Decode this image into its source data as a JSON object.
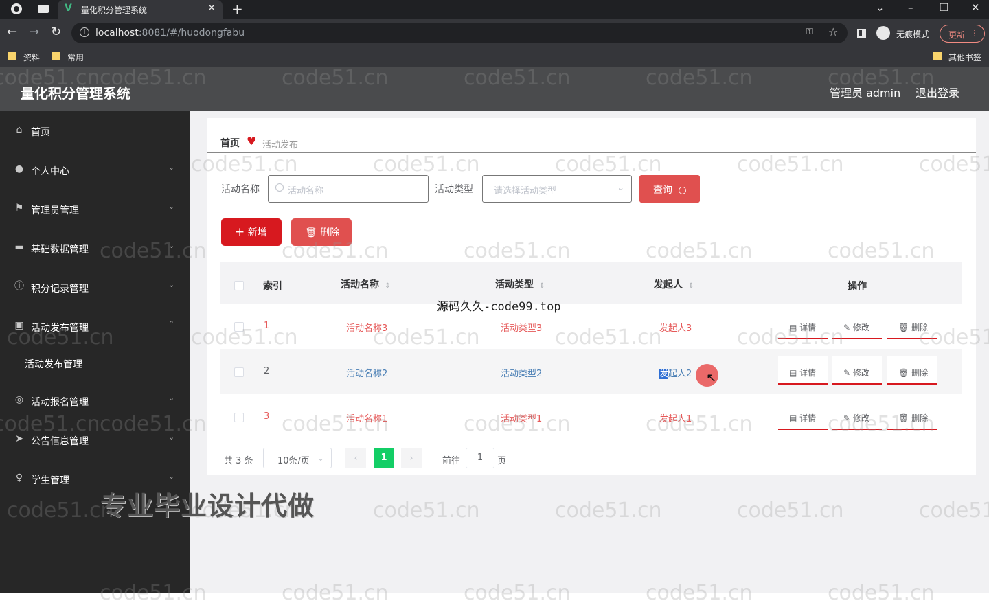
{
  "browser": {
    "tab_title": "量化积分管理系统",
    "tab_favicon": "V",
    "url_host": "localhost",
    "url_path": ":8081/#/huodongfabu",
    "incognito_label": "无痕模式",
    "update_label": "更新",
    "bookmarks": [
      "资料",
      "常用",
      "其他书签"
    ],
    "icons": [
      "back-icon",
      "forward-icon",
      "reload-icon",
      "key-icon",
      "star-icon",
      "incognito-icon",
      "kebab-icon"
    ]
  },
  "header": {
    "title": "量化积分管理系统",
    "admin_label": "管理员 admin",
    "logout_label": "退出登录"
  },
  "sidebar": {
    "items": [
      {
        "label": "首页",
        "icon": "home-icon"
      },
      {
        "label": "个人中心",
        "icon": "user-icon"
      },
      {
        "label": "管理员管理",
        "icon": "flag-icon"
      },
      {
        "label": "基础数据管理",
        "icon": "chat-icon"
      },
      {
        "label": "积分记录管理",
        "icon": "info-icon"
      },
      {
        "label": "活动发布管理",
        "icon": "trash-icon"
      },
      {
        "label": "活动报名管理",
        "icon": "circle-icon"
      },
      {
        "label": "公告信息管理",
        "icon": "send-icon"
      },
      {
        "label": "学生管理",
        "icon": "mic-icon"
      }
    ],
    "submenu_label": "活动发布管理"
  },
  "breadcrumb": {
    "home": "首页",
    "current": "活动发布"
  },
  "search": {
    "name_label": "活动名称",
    "name_placeholder": "活动名称",
    "type_label": "活动类型",
    "type_placeholder": "请选择活动类型",
    "query_button": "查询"
  },
  "actions": {
    "add_button": "新增",
    "delete_button": "删除"
  },
  "table": {
    "headers": {
      "index": "索引",
      "name": "活动名称",
      "type": "活动类型",
      "initiator": "发起人",
      "ops": "操作"
    },
    "rows": [
      {
        "index": "1",
        "name": "活动名称3",
        "type": "活动类型3",
        "initiator": "发起人3"
      },
      {
        "index": "2",
        "name": "活动名称2",
        "type": "活动类型2",
        "initiator_selected": "发",
        "initiator_rest": "起人2"
      },
      {
        "index": "3",
        "name": "活动名称1",
        "type": "活动类型1",
        "initiator": "发起人1"
      }
    ],
    "op_labels": {
      "detail": "详情",
      "edit": "修改",
      "delete": "删除"
    }
  },
  "pagination": {
    "total_text": "共 3 条",
    "page_size": "10条/页",
    "current_page": "1",
    "goto_label": "前往",
    "goto_value": "1",
    "page_suffix": "页"
  },
  "overlays": {
    "watermark": "code51.cn",
    "source_text": "源码久久-code99.top",
    "promo_text": "专业毕业设计代做"
  }
}
